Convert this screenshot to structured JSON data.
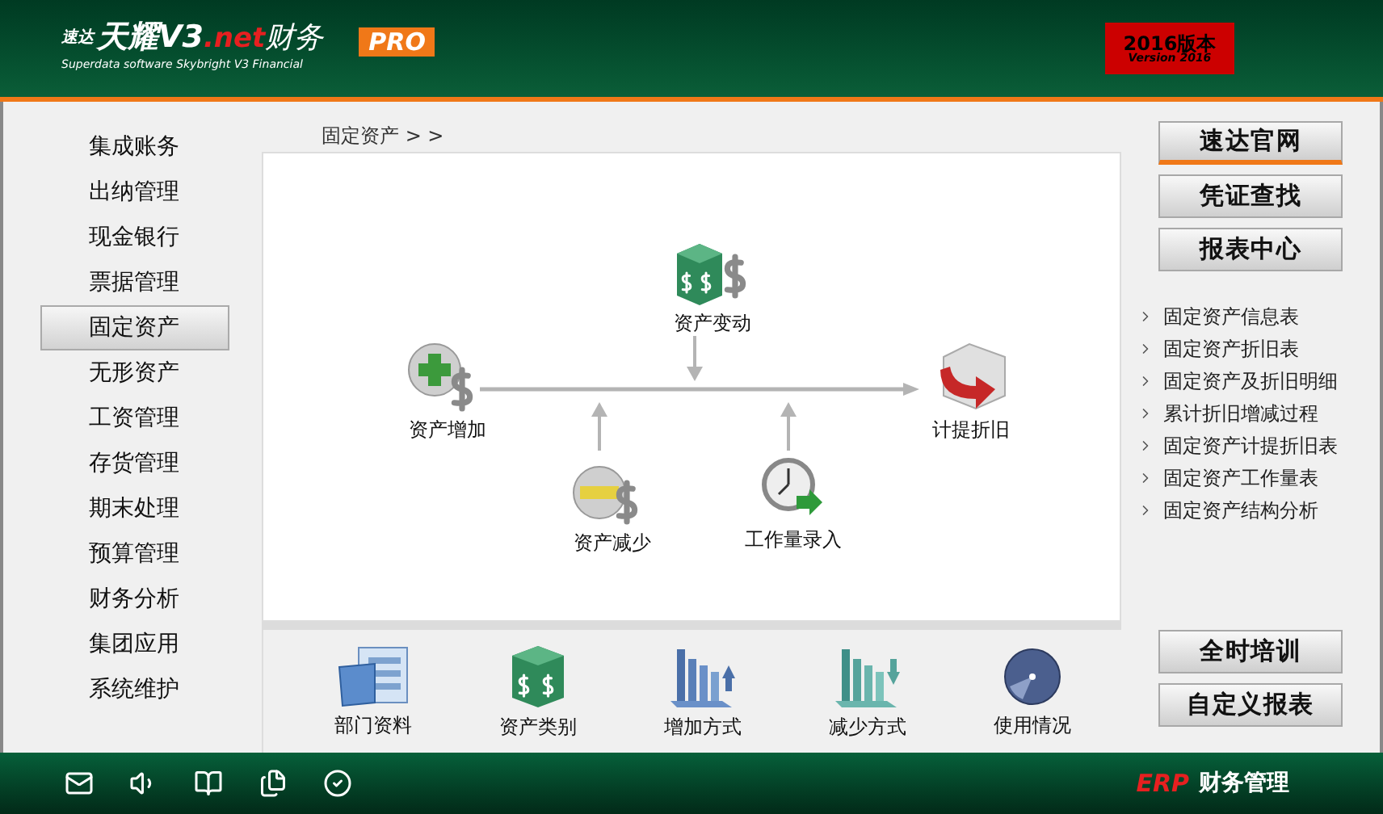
{
  "header": {
    "logo_prefix": "速达",
    "logo_name": "天耀V3",
    "logo_suffix": ".net",
    "logo_product": "财务",
    "subtitle": "Superdata software Skybright V3 Financial",
    "edition": "PRO",
    "version_badge": {
      "title": "2016版本",
      "subtitle": "Version 2016"
    }
  },
  "sidebar": {
    "items": [
      {
        "label": "集成账务",
        "selected": false
      },
      {
        "label": "出纳管理",
        "selected": false
      },
      {
        "label": "现金银行",
        "selected": false
      },
      {
        "label": "票据管理",
        "selected": false
      },
      {
        "label": "固定资产",
        "selected": true
      },
      {
        "label": "无形资产",
        "selected": false
      },
      {
        "label": "工资管理",
        "selected": false
      },
      {
        "label": "存货管理",
        "selected": false
      },
      {
        "label": "期末处理",
        "selected": false
      },
      {
        "label": "预算管理",
        "selected": false
      },
      {
        "label": "财务分析",
        "selected": false
      },
      {
        "label": "集团应用",
        "selected": false
      },
      {
        "label": "系统维护",
        "selected": false
      }
    ]
  },
  "breadcrumb": "固定资产 > >",
  "diagram": {
    "nodes": [
      {
        "label": "资产变动",
        "kind": "change"
      },
      {
        "label": "资产增加",
        "kind": "increase"
      },
      {
        "label": "计提折旧",
        "kind": "depreciation"
      },
      {
        "label": "资产减少",
        "kind": "decrease"
      },
      {
        "label": "工作量录入",
        "kind": "workload"
      }
    ]
  },
  "toolbar": {
    "items": [
      {
        "label": "部门资料",
        "kind": "department"
      },
      {
        "label": "资产类别",
        "kind": "category"
      },
      {
        "label": "增加方式",
        "kind": "add-method"
      },
      {
        "label": "减少方式",
        "kind": "reduce-method"
      },
      {
        "label": "使用情况",
        "kind": "usage"
      }
    ]
  },
  "right_panel": {
    "top_buttons": [
      {
        "label": "速达官网",
        "selected": true
      },
      {
        "label": "凭证查找",
        "selected": false
      },
      {
        "label": "报表中心",
        "selected": false
      }
    ],
    "report_links": [
      "固定资产信息表",
      "固定资产折旧表",
      "固定资产及折旧明细",
      "累计折旧增减过程",
      "固定资产计提折旧表",
      "固定资产工作量表",
      "固定资产结构分析"
    ],
    "bottom_buttons": [
      "全时培训",
      "自定义报表"
    ]
  },
  "footer": {
    "brand_prefix": "ERP",
    "brand_label": "财务管理"
  }
}
